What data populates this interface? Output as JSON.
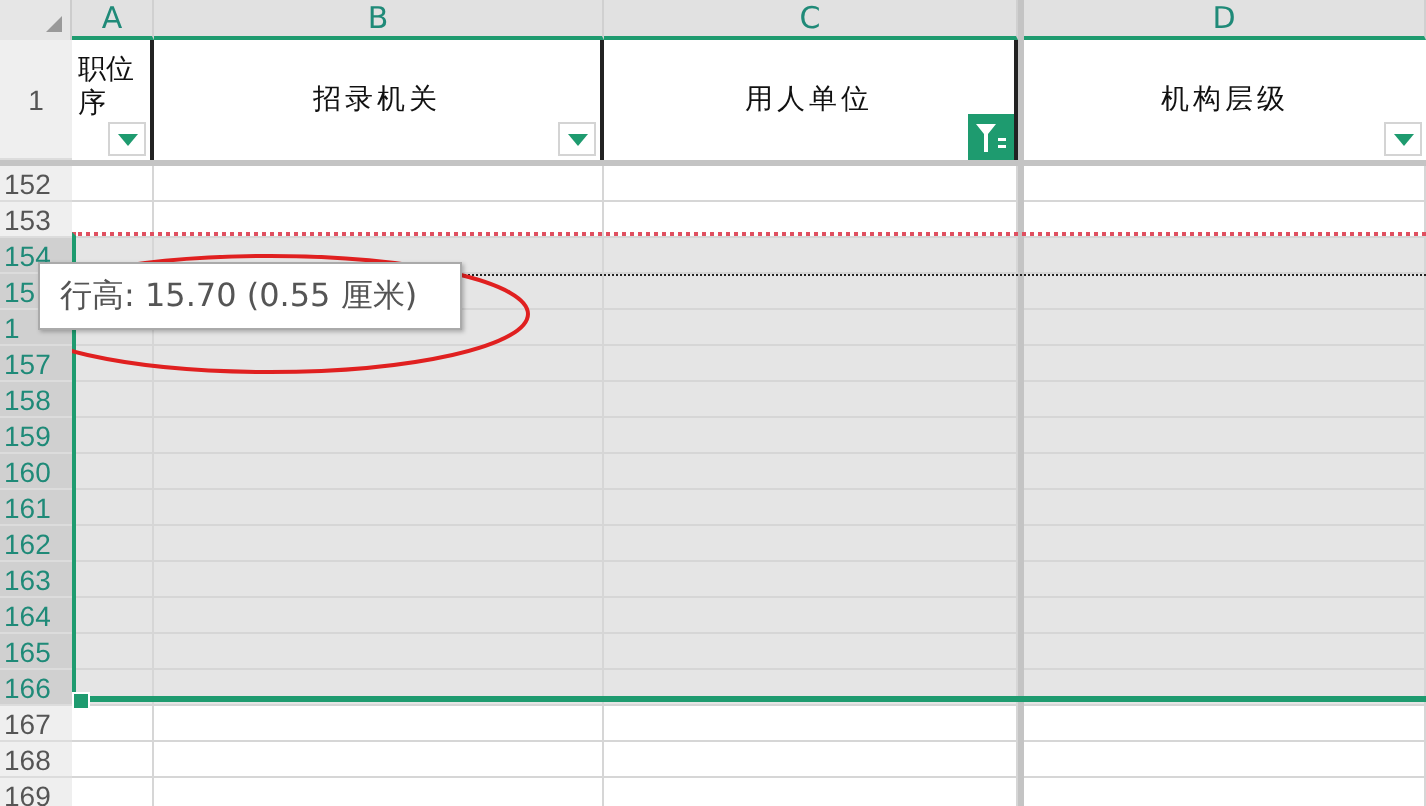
{
  "columns": [
    {
      "label": "A",
      "selected": true
    },
    {
      "label": "B",
      "selected": true
    },
    {
      "label": "C",
      "selected": true
    },
    {
      "label": "D",
      "selected": true
    }
  ],
  "header_row": {
    "row_number": "1",
    "cells": [
      {
        "text": "职位序",
        "kind": "dropdown"
      },
      {
        "text": "招录机关",
        "kind": "dropdown"
      },
      {
        "text": "用人单位",
        "kind": "filtered"
      },
      {
        "text": "机构层级",
        "kind": "dropdown"
      }
    ]
  },
  "rows": [
    {
      "number": "152",
      "selected": false
    },
    {
      "number": "153",
      "selected": false
    },
    {
      "number": "154",
      "selected": true
    },
    {
      "number": "15",
      "selected": true
    },
    {
      "number": "1",
      "selected": true
    },
    {
      "number": "157",
      "selected": true
    },
    {
      "number": "158",
      "selected": true
    },
    {
      "number": "159",
      "selected": true
    },
    {
      "number": "160",
      "selected": true
    },
    {
      "number": "161",
      "selected": true
    },
    {
      "number": "162",
      "selected": true
    },
    {
      "number": "163",
      "selected": true
    },
    {
      "number": "164",
      "selected": true
    },
    {
      "number": "165",
      "selected": true
    },
    {
      "number": "166",
      "selected": true
    },
    {
      "number": "167",
      "selected": false
    },
    {
      "number": "168",
      "selected": false
    },
    {
      "number": "169",
      "selected": false
    }
  ],
  "tooltip": {
    "text": "行高: 15.70 (0.55 厘米)"
  }
}
